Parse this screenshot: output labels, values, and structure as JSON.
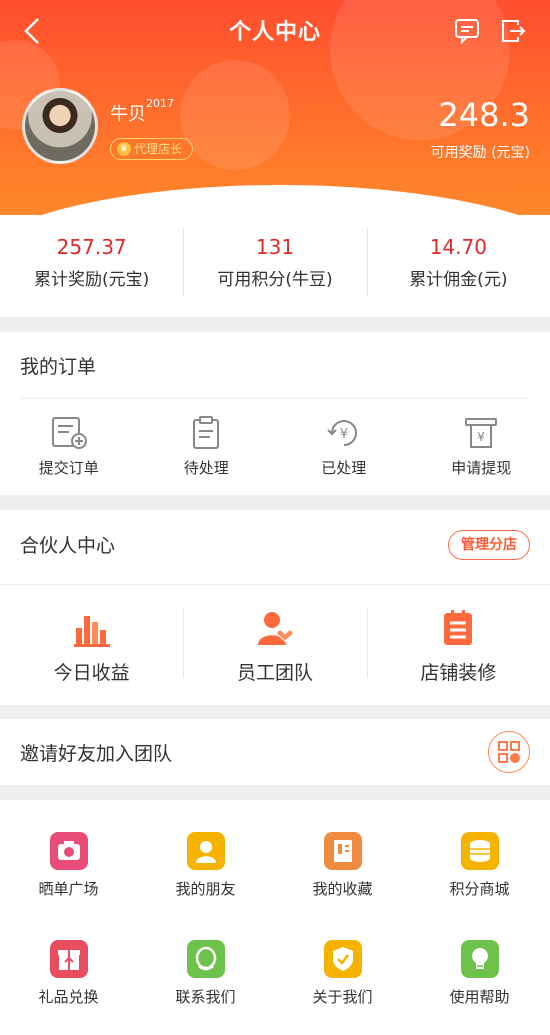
{
  "nav": {
    "title": "个人中心",
    "back_icon": "back-arrow-icon",
    "message_icon": "message-icon",
    "exit_icon": "exit-icon"
  },
  "profile": {
    "username": "牛贝",
    "username_sup": "2017",
    "role": "代理店长",
    "available_value": "248.3",
    "available_label": "可用奖励 (元宝)"
  },
  "stats": [
    {
      "value": "257.37",
      "label": "累计奖励(元宝)"
    },
    {
      "value": "131",
      "label": "可用积分(牛豆)"
    },
    {
      "value": "14.70",
      "label": "累计佣金(元)"
    }
  ],
  "orders": {
    "title": "我的订单",
    "items": [
      {
        "label": "提交订单",
        "icon": "submit-order-icon"
      },
      {
        "label": "待处理",
        "icon": "clipboard-icon"
      },
      {
        "label": "已处理",
        "icon": "yuan-refresh-icon"
      },
      {
        "label": "申请提现",
        "icon": "withdraw-icon"
      }
    ]
  },
  "partner": {
    "title": "合伙人中心",
    "manage_button": "管理分店",
    "items": [
      {
        "label": "今日收益",
        "icon": "bar-chart-icon"
      },
      {
        "label": "员工团队",
        "icon": "team-icon"
      },
      {
        "label": "店铺装修",
        "icon": "decorate-icon"
      }
    ]
  },
  "invite": {
    "title": "邀请好友加入团队",
    "icon": "qr-code-icon"
  },
  "grid": [
    {
      "label": "晒单广场",
      "icon": "camera-icon",
      "color": "#e84d7a"
    },
    {
      "label": "我的朋友",
      "icon": "friend-icon",
      "color": "#f5b300"
    },
    {
      "label": "我的收藏",
      "icon": "bookmark-icon",
      "color": "#f08a3e"
    },
    {
      "label": "积分商城",
      "icon": "coins-icon",
      "color": "#f5b300"
    },
    {
      "label": "礼品兑换",
      "icon": "gift-icon",
      "color": "#e84d5e"
    },
    {
      "label": "联系我们",
      "icon": "contact-icon",
      "color": "#6cc24a"
    },
    {
      "label": "关于我们",
      "icon": "shield-check-icon",
      "color": "#f5b300"
    },
    {
      "label": "使用帮助",
      "icon": "bulb-icon",
      "color": "#6cc24a"
    }
  ],
  "colors": {
    "primary": "#ff5a35",
    "value_red": "#e02a2a"
  }
}
